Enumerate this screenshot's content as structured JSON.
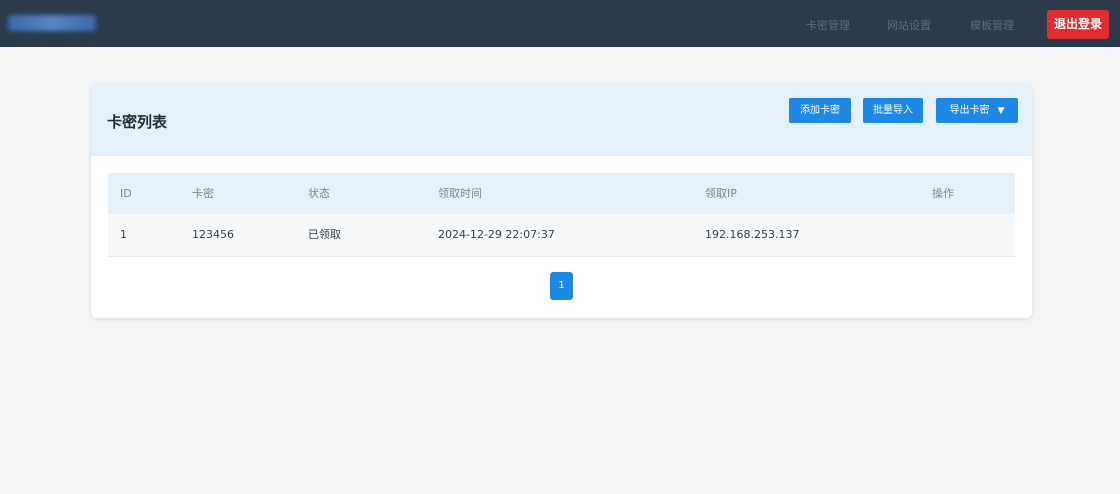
{
  "header": {
    "nav": [
      "卡密管理",
      "网站设置",
      "模板管理"
    ],
    "logout_label": "退出登录"
  },
  "card": {
    "title": "卡密列表",
    "buttons": {
      "add": "添加卡密",
      "import": "批量导入",
      "export": "导出卡密"
    }
  },
  "table": {
    "columns": [
      "ID",
      "卡密",
      "状态",
      "领取时间",
      "领取IP",
      "操作"
    ],
    "rows": [
      [
        "1",
        "123456",
        "已领取",
        "2024-12-29 22:07:37",
        "192.168.253.137",
        ""
      ]
    ]
  },
  "pagination": {
    "current_page": "1"
  },
  "colors": {
    "topbar": "#2c3a4b",
    "primary": "#1e88e5",
    "danger": "#e02d2d",
    "card_header": "#e4f1fb"
  }
}
